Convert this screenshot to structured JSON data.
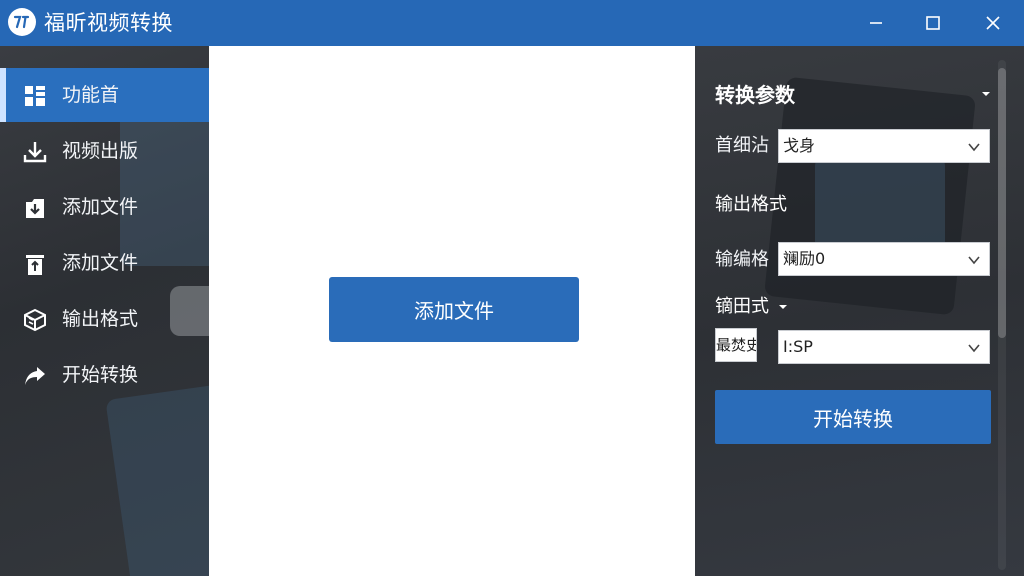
{
  "app": {
    "title": "福昕视频转换",
    "logo_icon": "app-logo-icon"
  },
  "window_controls": {
    "minimize_icon": "minimize-icon",
    "maximize_icon": "maximize-icon",
    "close_icon": "close-icon"
  },
  "sidebar": {
    "items": [
      {
        "label": "功能首",
        "icon": "grid-icon",
        "active": true
      },
      {
        "label": "视频出版",
        "icon": "download-icon",
        "active": false
      },
      {
        "label": "添加文件",
        "icon": "file-import-icon",
        "active": false
      },
      {
        "label": "添加文件",
        "icon": "trash-icon",
        "active": false
      },
      {
        "label": "输出格式",
        "icon": "cube-icon",
        "active": false
      },
      {
        "label": "开始转换",
        "icon": "share-arrow-icon",
        "active": false
      }
    ]
  },
  "main": {
    "add_file_label": "添加文件"
  },
  "panel": {
    "title": "转换参数",
    "fields": [
      {
        "label": "首细沾",
        "value": "戈身"
      },
      {
        "section": "输出格式"
      },
      {
        "label": "输编格",
        "value": "斓励0"
      },
      {
        "section": "镝田式"
      },
      {
        "label": "最焚史",
        "value": "I:SP"
      }
    ],
    "field1_label": "首细沾",
    "field1_value": "戈身",
    "section1": "输出格式",
    "field2_label": "输编格",
    "field2_value": "斓励0",
    "section2": "镝田式",
    "mini_label": "最焚史",
    "field3_value": "I:SP",
    "start_label": "开始转换"
  },
  "colors": {
    "accent": "#2a6cb9",
    "titlebar": "#2668b6",
    "dark_bg": "#2b2e33"
  }
}
